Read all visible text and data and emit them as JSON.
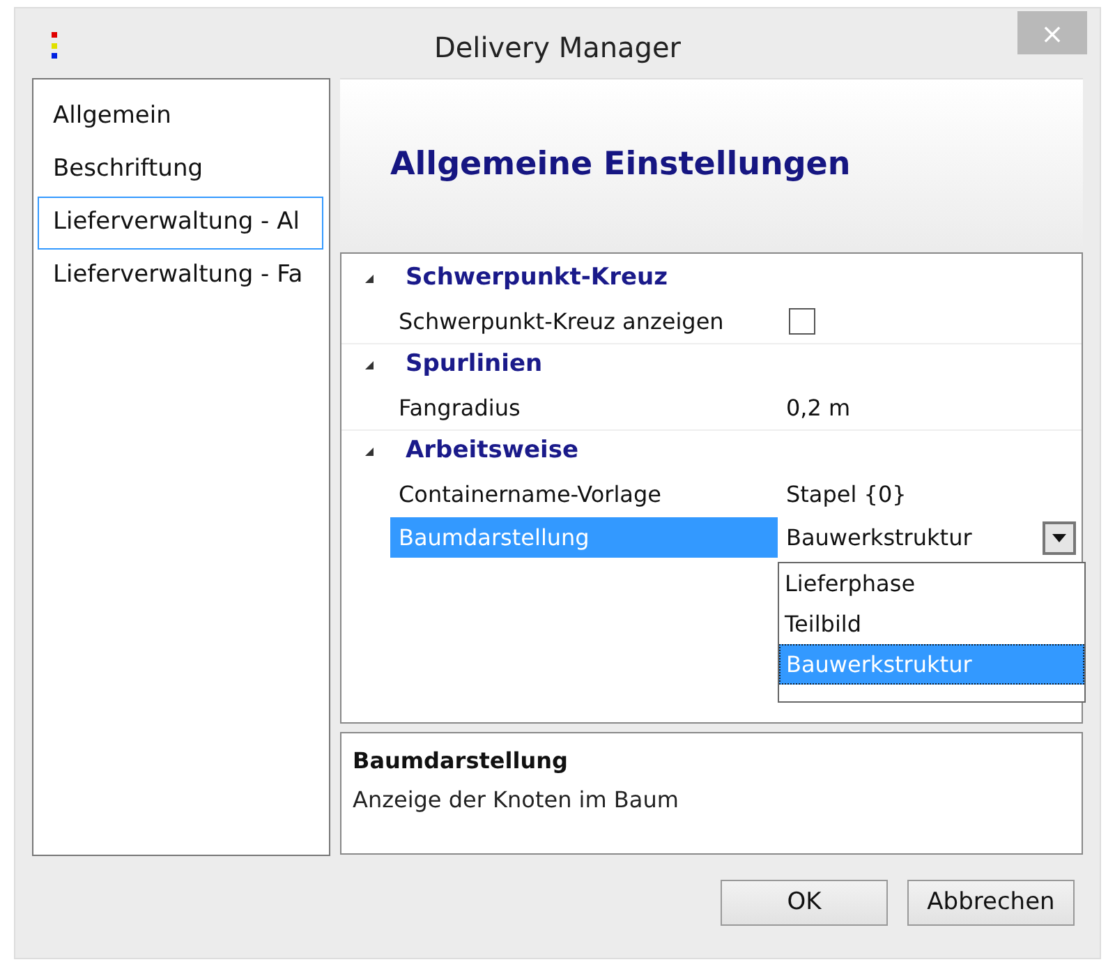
{
  "window": {
    "title": "Delivery Manager",
    "close": "×"
  },
  "sidebar": {
    "items": [
      {
        "label": "Allgemein",
        "selected": false
      },
      {
        "label": "Beschriftung",
        "selected": false
      },
      {
        "label": "Lieferverwaltung - Al",
        "selected": true
      },
      {
        "label": "Lieferverwaltung - Fa",
        "selected": false
      }
    ]
  },
  "header": {
    "title": "Allgemeine Einstellungen"
  },
  "properties": {
    "categories": [
      {
        "name": "Schwerpunkt-Kreuz",
        "expanded": true,
        "items": [
          {
            "kind": "checkbox",
            "name": "Schwerpunkt-Kreuz anzeigen",
            "checked": false,
            "selected": false
          }
        ]
      },
      {
        "name": "Spurlinien",
        "expanded": true,
        "items": [
          {
            "kind": "text",
            "name": "Fangradius",
            "value": "0,2 m",
            "selected": false
          }
        ]
      },
      {
        "name": "Arbeitsweise",
        "expanded": true,
        "items": [
          {
            "kind": "text",
            "name": "Containername-Vorlage",
            "value": "Stapel {0}",
            "selected": false
          },
          {
            "kind": "dropdown",
            "name": "Baumdarstellung",
            "value": "Bauwerkstruktur",
            "selected": true,
            "expanded": true,
            "options": [
              {
                "label": "Lieferphase",
                "selected": false
              },
              {
                "label": "Teilbild",
                "selected": false
              },
              {
                "label": "Bauwerkstruktur",
                "selected": true
              }
            ]
          }
        ]
      }
    ]
  },
  "description": {
    "title": "Baumdarstellung",
    "text": "Anzeige der Knoten im Baum"
  },
  "buttons": [
    "OK",
    "Abbrechen"
  ]
}
